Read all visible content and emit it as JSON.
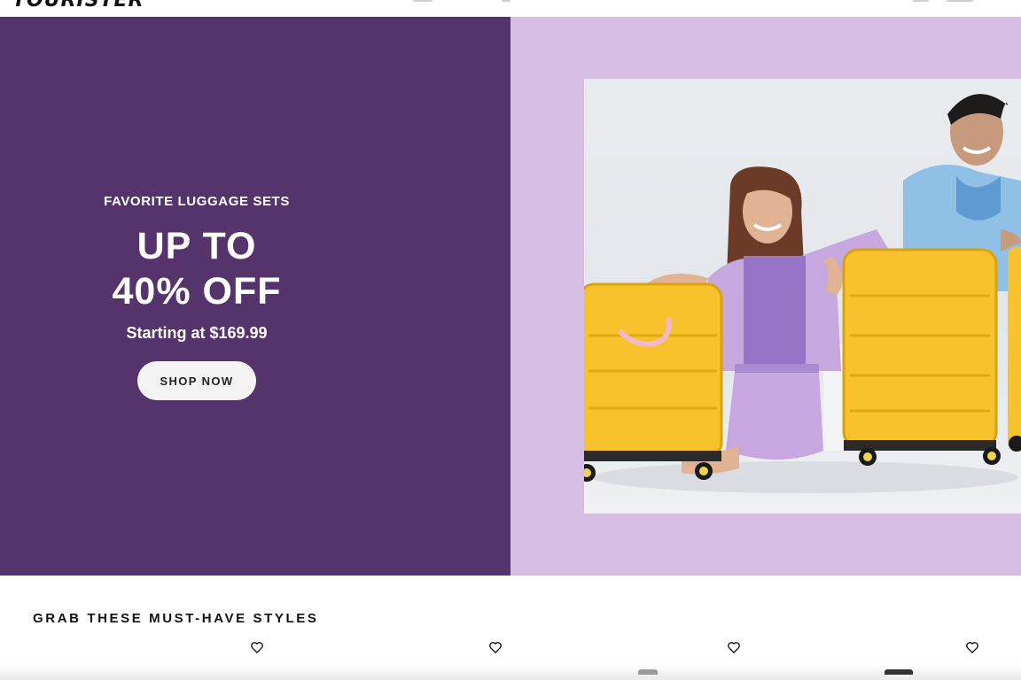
{
  "header": {
    "logo_text": "TOURISTER"
  },
  "hero": {
    "eyebrow": "FAVORITE LUGGAGE SETS",
    "headline_line1": "UP TO",
    "headline_line2": "40% OFF",
    "subtext": "Starting at $169.99",
    "cta_label": "SHOP NOW",
    "colors": {
      "left_panel": "#55336b",
      "right_panel": "#d5bde3",
      "luggage": "#f7c22c",
      "button_bg": "#f3f3f3"
    }
  },
  "section": {
    "title": "GRAB THESE MUST-HAVE STYLES"
  },
  "icons": {
    "wishlist": "heart-icon"
  }
}
